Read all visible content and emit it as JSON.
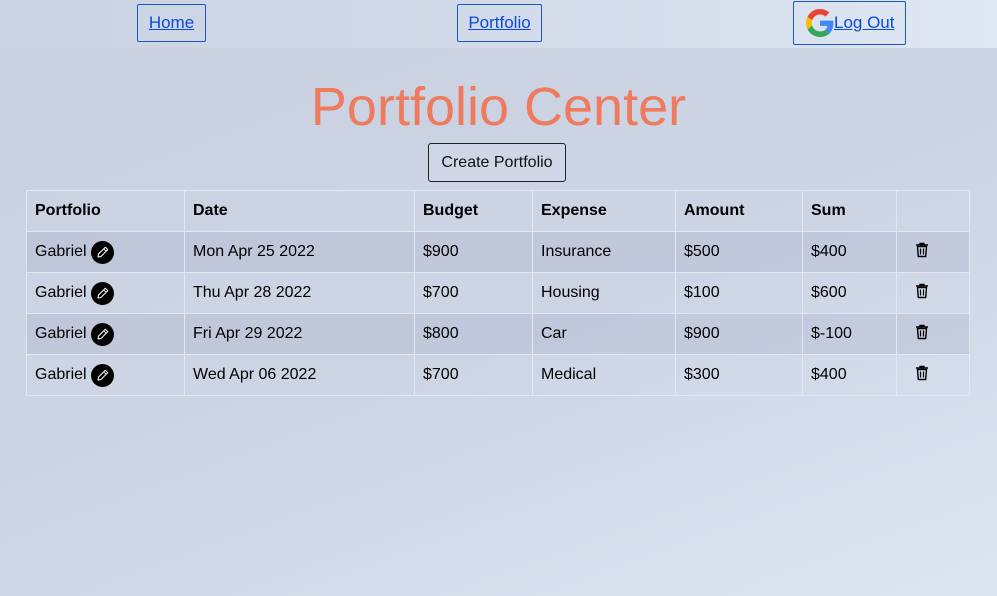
{
  "nav": {
    "home_label": "Home",
    "portfolio_label": "Portfolio",
    "logout_label": "Log Out",
    "logout_icon": "google-icon"
  },
  "page": {
    "title": "Portfolio Center",
    "create_button_label": "Create Portfolio",
    "title_color": "#ee7b5e"
  },
  "table": {
    "headers": [
      "Portfolio",
      "Date",
      "Budget",
      "Expense",
      "Amount",
      "Sum",
      ""
    ],
    "rows": [
      {
        "portfolio": "Gabriel",
        "date": "Mon Apr 25 2022",
        "budget": "$900",
        "expense": "Insurance",
        "amount": "$500",
        "sum": "$400"
      },
      {
        "portfolio": "Gabriel",
        "date": "Thu Apr 28 2022",
        "budget": "$700",
        "expense": "Housing",
        "amount": "$100",
        "sum": "$600"
      },
      {
        "portfolio": "Gabriel",
        "date": "Fri Apr 29 2022",
        "budget": "$800",
        "expense": "Car",
        "amount": "$900",
        "sum": "$-100"
      },
      {
        "portfolio": "Gabriel",
        "date": "Wed Apr 06 2022",
        "budget": "$700",
        "expense": "Medical",
        "amount": "$300",
        "sum": "$400"
      }
    ],
    "row_icons": {
      "edit": "pencil-icon",
      "delete": "trash-icon"
    }
  }
}
